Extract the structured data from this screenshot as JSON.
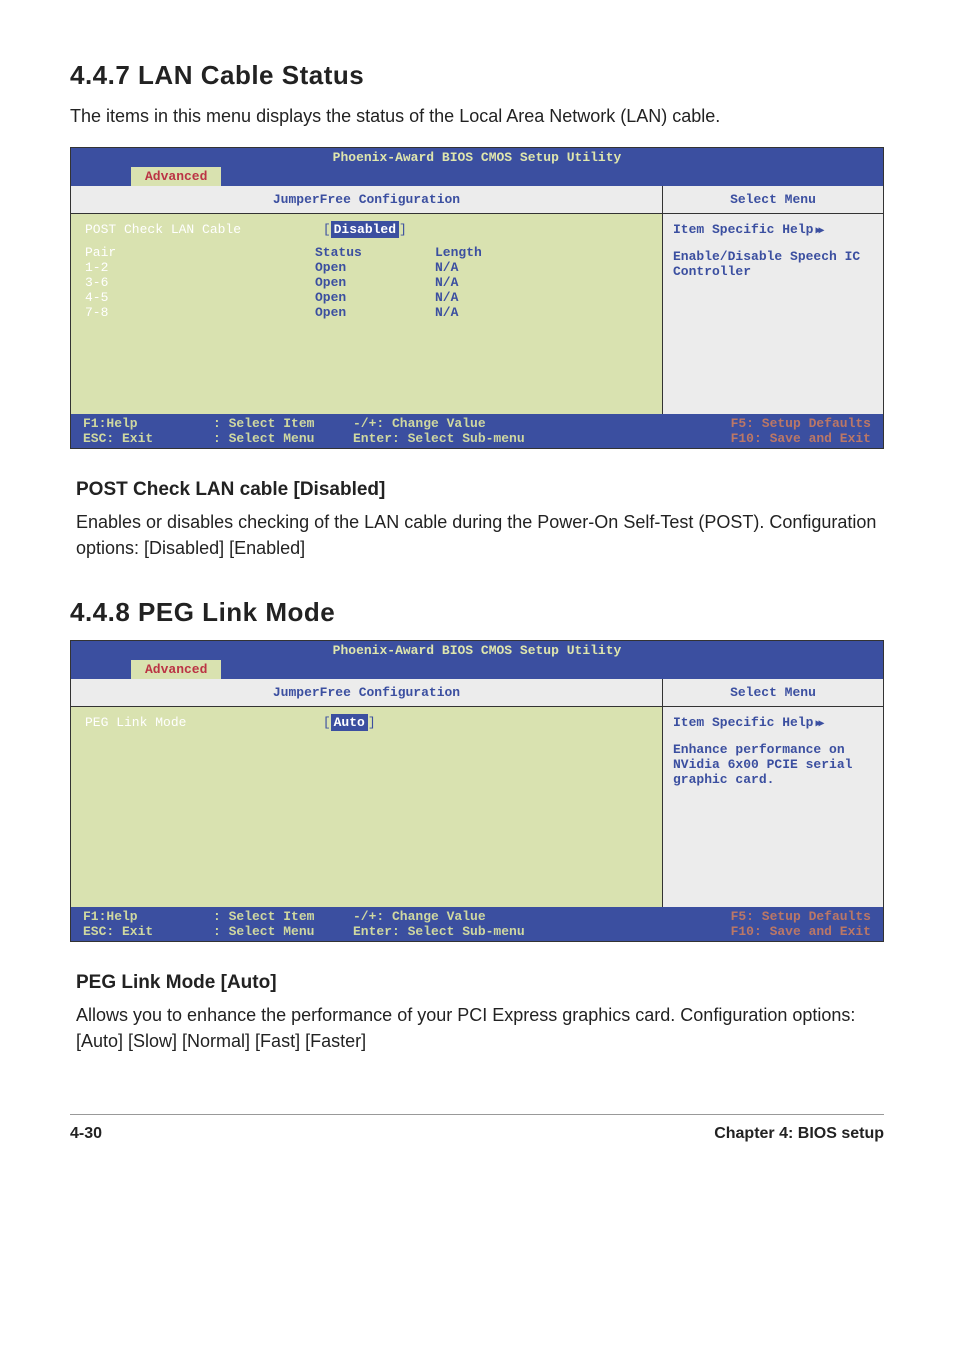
{
  "sections": {
    "s1": {
      "title": "4.4.7  LAN Cable Status",
      "intro": "The items in this menu displays the status of the Local Area Network (LAN) cable."
    },
    "s2": {
      "title": "4.4.8  PEG Link Mode"
    }
  },
  "bios_common": {
    "window_title": "Phoenix-Award BIOS CMOS Setup Utility",
    "tab_label": "Advanced",
    "subhead_left": "JumperFree Configuration",
    "subhead_right": "Select Menu",
    "help_heading": "Item Specific Help",
    "footer": {
      "f1": "F1:Help",
      "esc": "ESC: Exit",
      "sel_item": ": Select Item",
      "sel_menu": ": Select Menu",
      "change": "-/+: Change Value",
      "enter": "Enter: Select Sub-menu",
      "f5": "F5: Setup Defaults",
      "f10": "F10: Save and Exit"
    }
  },
  "bios1": {
    "row0_label": "POST Check LAN Cable",
    "row0_value": "Disabled",
    "head_pair": "Pair",
    "head_status": "Status",
    "head_length": "Length",
    "rows": [
      {
        "pair": "1-2",
        "status": "Open",
        "length": "N/A"
      },
      {
        "pair": "3-6",
        "status": "Open",
        "length": "N/A"
      },
      {
        "pair": "4-5",
        "status": "Open",
        "length": "N/A"
      },
      {
        "pair": "7-8",
        "status": "Open",
        "length": "N/A"
      }
    ],
    "help_text": "Enable/Disable Speech IC Controller"
  },
  "bios2": {
    "row0_label": "PEG Link Mode",
    "row0_value": "Auto",
    "help_text": "Enhance performance on NVidia 6x00 PCIE serial graphic card."
  },
  "subsec1": {
    "heading": "POST Check LAN cable [Disabled]",
    "body": "Enables or disables checking of the LAN cable during the Power-On Self-Test (POST). Configuration options: [Disabled] [Enabled]"
  },
  "subsec2": {
    "heading": "PEG Link Mode [Auto]",
    "body": "Allows you to enhance the performance of your PCI Express graphics card. Configuration options: [Auto] [Slow] [Normal] [Fast] [Faster]"
  },
  "footer": {
    "page": "4-30",
    "chapter": "Chapter 4: BIOS setup"
  }
}
